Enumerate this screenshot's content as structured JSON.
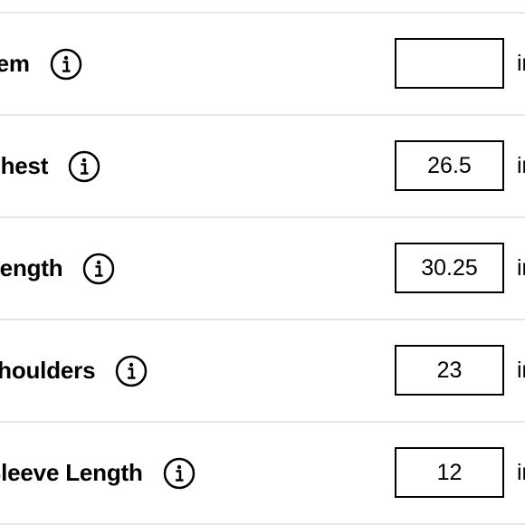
{
  "measurements": [
    {
      "label": "Hem",
      "value": "",
      "unit": "in"
    },
    {
      "label": "Chest",
      "value": "26.5",
      "unit": "in"
    },
    {
      "label": "Length",
      "value": "30.25",
      "unit": "in"
    },
    {
      "label": "Shoulders",
      "value": "23",
      "unit": "in"
    },
    {
      "label": "Sleeve Length",
      "value": "12",
      "unit": "in"
    }
  ],
  "icons": {
    "info": "info-circle-icon"
  }
}
